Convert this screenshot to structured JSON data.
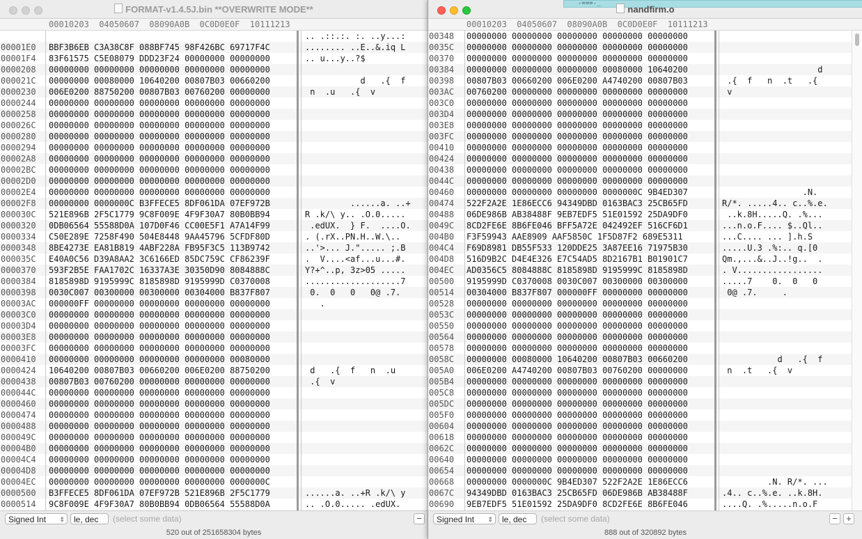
{
  "left": {
    "title": "FORMAT-v1.4.5J.bin **OVERWRITE MODE**",
    "col_headers": [
      "00010203",
      "04050607",
      "08090A0B",
      "0C0D0E0F",
      "10111213"
    ],
    "rows": [
      {
        "offset": "",
        "hex": "",
        "ascii": ".. .::.:. :. ..y...:"
      },
      {
        "offset": "00001E0",
        "hex": "BBF3B6EB C3A38C8F 088BF745 98F426BC 69717F4C",
        "ascii": "........ ..E..&.iq L"
      },
      {
        "offset": "00001F4",
        "hex": "83F61575 C5E08079 DDD23F24 00000000 00000000",
        "ascii": ".. u...y..?$"
      },
      {
        "offset": "0000208",
        "hex": "00000000 00000000 00000000 00000000 00000000",
        "ascii": ""
      },
      {
        "offset": "000021C",
        "hex": "00000000 00080000 10640200 00807B03 00660200",
        "ascii": "           d   .{  f"
      },
      {
        "offset": "0000230",
        "hex": "006E0200 88750200 00807B03 00760200 00000000",
        "ascii": " n  .u   .{  v"
      },
      {
        "offset": "0000244",
        "hex": "00000000 00000000 00000000 00000000 00000000",
        "ascii": ""
      },
      {
        "offset": "0000258",
        "hex": "00000000 00000000 00000000 00000000 00000000",
        "ascii": ""
      },
      {
        "offset": "000026C",
        "hex": "00000000 00000000 00000000 00000000 00000000",
        "ascii": ""
      },
      {
        "offset": "0000280",
        "hex": "00000000 00000000 00000000 00000000 00000000",
        "ascii": ""
      },
      {
        "offset": "0000294",
        "hex": "00000000 00000000 00000000 00000000 00000000",
        "ascii": ""
      },
      {
        "offset": "00002A8",
        "hex": "00000000 00000000 00000000 00000000 00000000",
        "ascii": ""
      },
      {
        "offset": "00002BC",
        "hex": "00000000 00000000 00000000 00000000 00000000",
        "ascii": ""
      },
      {
        "offset": "00002D0",
        "hex": "00000000 00000000 00000000 00000000 00000000",
        "ascii": ""
      },
      {
        "offset": "00002E4",
        "hex": "00000000 00000000 00000000 00000000 00000000",
        "ascii": ""
      },
      {
        "offset": "00002F8",
        "hex": "00000000 0000000C B3FFECE5 8DF061DA 07EF972B",
        "ascii": "         ......a. ..+"
      },
      {
        "offset": "000030C",
        "hex": "521E896B 2F5C1779 9C8F009E 4F9F30A7 80B0BB94",
        "ascii": "R .k/\\ y.. .O.0....."
      },
      {
        "offset": "0000320",
        "hex": "0DB06564 55588D0A 107D0F46 CC00E5F1 A7A14F99",
        "ascii": " .edUX.  } F.  ....O."
      },
      {
        "offset": "0000334",
        "hex": "C50E289E 7258F490 504E8448 9AA45796 5CFDF80D",
        "ascii": ". (.rX..PN.H..W.\\.."
      },
      {
        "offset": "0000348",
        "hex": "8BE4273E EA81B819 4ABF228A FB95F3C5 113B9742",
        "ascii": "..'>... J.\"..... ;.B"
      },
      {
        "offset": "000035C",
        "hex": "E40A0C56 D39A8AA2 3C6166ED 85DC759C CF86239F",
        "ascii": ".  V....<af...u...#."
      },
      {
        "offset": "0000370",
        "hex": "593F2B5E FAA1702C 16337A3E 30350D90 8084888C",
        "ascii": "Y?+^..p, 3z>05 ....."
      },
      {
        "offset": "0000384",
        "hex": "8185898D 9195999C 8185898D 9195999D C0370008",
        "ascii": "...................7"
      },
      {
        "offset": "0000398",
        "hex": "0030C007 00300000 00300000 00304000 B837F807",
        "ascii": " 0.  0   0   0@ .7."
      },
      {
        "offset": "00003AC",
        "hex": "000000FF 00000000 00000000 00000000 00000000",
        "ascii": "   ."
      },
      {
        "offset": "00003C0",
        "hex": "00000000 00000000 00000000 00000000 00000000",
        "ascii": ""
      },
      {
        "offset": "00003D4",
        "hex": "00000000 00000000 00000000 00000000 00000000",
        "ascii": ""
      },
      {
        "offset": "00003E8",
        "hex": "00000000 00000000 00000000 00000000 00000000",
        "ascii": ""
      },
      {
        "offset": "00003FC",
        "hex": "00000000 00000000 00000000 00000000 00000000",
        "ascii": ""
      },
      {
        "offset": "0000410",
        "hex": "00000000 00000000 00000000 00000000 00080000",
        "ascii": ""
      },
      {
        "offset": "0000424",
        "hex": "10640200 00807B03 00660200 006E0200 88750200",
        "ascii": " d   .{  f   n  .u"
      },
      {
        "offset": "0000438",
        "hex": "00807B03 00760200 00000000 00000000 00000000",
        "ascii": " .{  v"
      },
      {
        "offset": "000044C",
        "hex": "00000000 00000000 00000000 00000000 00000000",
        "ascii": ""
      },
      {
        "offset": "0000460",
        "hex": "00000000 00000000 00000000 00000000 00000000",
        "ascii": ""
      },
      {
        "offset": "0000474",
        "hex": "00000000 00000000 00000000 00000000 00000000",
        "ascii": ""
      },
      {
        "offset": "0000488",
        "hex": "00000000 00000000 00000000 00000000 00000000",
        "ascii": ""
      },
      {
        "offset": "000049C",
        "hex": "00000000 00000000 00000000 00000000 00000000",
        "ascii": ""
      },
      {
        "offset": "00004B0",
        "hex": "00000000 00000000 00000000 00000000 00000000",
        "ascii": ""
      },
      {
        "offset": "00004C4",
        "hex": "00000000 00000000 00000000 00000000 00000000",
        "ascii": ""
      },
      {
        "offset": "00004D8",
        "hex": "00000000 00000000 00000000 00000000 00000000",
        "ascii": ""
      },
      {
        "offset": "00004EC",
        "hex": "00000000 00000000 00000000 00000000 0000000C",
        "ascii": ""
      },
      {
        "offset": "0000500",
        "hex": "B3FFECE5 8DF061DA 07EF972B 521E896B 2F5C1779",
        "ascii": "......a. ..+R .k/\\ y"
      },
      {
        "offset": "0000514",
        "hex": "9C8F009E 4F9F30A7 80B0BB94 0DB06564 55588D0A",
        "ascii": ".. .O.0..... .edUX."
      },
      {
        "offset": "0000528",
        "hex": "107D0F46 CC00E5F1 A7A14F99 C50E289E 7258F490",
        "ascii": " } F.  ....O. . (.rX."
      }
    ],
    "status": {
      "type_select": "Signed Int",
      "endian_select": "le, dec",
      "hint": "(select some data)",
      "bytes": "520 out of 251658304 bytes"
    }
  },
  "right": {
    "title": "nandfirm.o",
    "teal_text": "-===-_",
    "col_headers": [
      "00010203",
      "04050607",
      "08090A0B",
      "0C0D0E0F",
      "10111213"
    ],
    "rows": [
      {
        "offset": "00348",
        "hex": "00000000 00000000 00000000 00000000 00000000",
        "ascii": ""
      },
      {
        "offset": "0035C",
        "hex": "00000000 00000000 00000000 00000000 00000000",
        "ascii": ""
      },
      {
        "offset": "00370",
        "hex": "00000000 00000000 00000000 00000000 00000000",
        "ascii": ""
      },
      {
        "offset": "00384",
        "hex": "00000000 00000000 00000000 00080000 10640200",
        "ascii": "                   d"
      },
      {
        "offset": "00398",
        "hex": "00807B03 00660200 006E0200 A4740200 00807B03",
        "ascii": " .{  f   n  .t   .{"
      },
      {
        "offset": "003AC",
        "hex": "00760200 00000000 00000000 00000000 00000000",
        "ascii": " v"
      },
      {
        "offset": "003C0",
        "hex": "00000000 00000000 00000000 00000000 00000000",
        "ascii": ""
      },
      {
        "offset": "003D4",
        "hex": "00000000 00000000 00000000 00000000 00000000",
        "ascii": ""
      },
      {
        "offset": "003E8",
        "hex": "00000000 00000000 00000000 00000000 00000000",
        "ascii": ""
      },
      {
        "offset": "003FC",
        "hex": "00000000 00000000 00000000 00000000 00000000",
        "ascii": ""
      },
      {
        "offset": "00410",
        "hex": "00000000 00000000 00000000 00000000 00000000",
        "ascii": ""
      },
      {
        "offset": "00424",
        "hex": "00000000 00000000 00000000 00000000 00000000",
        "ascii": ""
      },
      {
        "offset": "00438",
        "hex": "00000000 00000000 00000000 00000000 00000000",
        "ascii": ""
      },
      {
        "offset": "0044C",
        "hex": "00000000 00000000 00000000 00000000 00000000",
        "ascii": ""
      },
      {
        "offset": "00460",
        "hex": "00000000 00000000 00000000 0000000C 9B4ED307",
        "ascii": "                .N."
      },
      {
        "offset": "00474",
        "hex": "522F2A2E 1E86ECC6 94349DBD 0163BAC3 25CB65FD",
        "ascii": "R/*. .....4.. c..%.e."
      },
      {
        "offset": "00488",
        "hex": "06DE986B AB38488F 9EB7EDF5 51E01592 25DA9DF0",
        "ascii": " ..k.8H.....Q. .%..."
      },
      {
        "offset": "0049C",
        "hex": "8CD2FE6E 8B6FE046 BFF5A72E 042492EF 516CF6D1",
        "ascii": "...n.o.F.... $..Ql.."
      },
      {
        "offset": "004B0",
        "hex": "F3F59943 AAE8909 AAF5850C 1F5D87F2 689E5311",
        "ascii": "...C.... ... ].h.S"
      },
      {
        "offset": "004C4",
        "hex": "F69D8981 DB55F533 120DDE25 3A87EE16 71975B30",
        "ascii": ".....U.3 .%:.. q.[0"
      },
      {
        "offset": "004D8",
        "hex": "516D9B2C D4E4E326 E7C54AD5 8D2167B1 B01901C7",
        "ascii": "Qm.,...&..J..!g..  ."
      },
      {
        "offset": "004EC",
        "hex": "AD0356C5 8084888C 8185898D 9195999C 8185898D",
        "ascii": ". V................."
      },
      {
        "offset": "00500",
        "hex": "9195999D C0370008 0030C007 00300000 00300000",
        "ascii": ".....7    0.  0   0"
      },
      {
        "offset": "00514",
        "hex": "00304000 B837F807 000000FF 00000000 00000000",
        "ascii": " 0@ .7.     ."
      },
      {
        "offset": "00528",
        "hex": "00000000 00000000 00000000 00000000 00000000",
        "ascii": ""
      },
      {
        "offset": "0053C",
        "hex": "00000000 00000000 00000000 00000000 00000000",
        "ascii": ""
      },
      {
        "offset": "00550",
        "hex": "00000000 00000000 00000000 00000000 00000000",
        "ascii": ""
      },
      {
        "offset": "00564",
        "hex": "00000000 00000000 00000000 00000000 00000000",
        "ascii": ""
      },
      {
        "offset": "00578",
        "hex": "00000000 00000000 00000000 00000000 00000000",
        "ascii": ""
      },
      {
        "offset": "0058C",
        "hex": "00000000 00080000 10640200 00807B03 00660200",
        "ascii": "           d   .{  f"
      },
      {
        "offset": "005A0",
        "hex": "006E0200 A4740200 00807B03 00760200 00000000",
        "ascii": " n  .t   .{  v"
      },
      {
        "offset": "005B4",
        "hex": "00000000 00000000 00000000 00000000 00000000",
        "ascii": ""
      },
      {
        "offset": "005C8",
        "hex": "00000000 00000000 00000000 00000000 00000000",
        "ascii": ""
      },
      {
        "offset": "005DC",
        "hex": "00000000 00000000 00000000 00000000 00000000",
        "ascii": ""
      },
      {
        "offset": "005F0",
        "hex": "00000000 00000000 00000000 00000000 00000000",
        "ascii": ""
      },
      {
        "offset": "00604",
        "hex": "00000000 00000000 00000000 00000000 00000000",
        "ascii": ""
      },
      {
        "offset": "00618",
        "hex": "00000000 00000000 00000000 00000000 00000000",
        "ascii": ""
      },
      {
        "offset": "0062C",
        "hex": "00000000 00000000 00000000 00000000 00000000",
        "ascii": ""
      },
      {
        "offset": "00640",
        "hex": "00000000 00000000 00000000 00000000 00000000",
        "ascii": ""
      },
      {
        "offset": "00654",
        "hex": "00000000 00000000 00000000 00000000 00000000",
        "ascii": ""
      },
      {
        "offset": "00668",
        "hex": "00000000 0000000C 9B4ED307 522F2A2E 1E86ECC6",
        "ascii": "         .N. R/*. ..."
      },
      {
        "offset": "0067C",
        "hex": "94349DBD 0163BAC3 25CB65FD 06DE986B AB38488F",
        "ascii": ".4.. c..%.e. ..k.8H."
      },
      {
        "offset": "00690",
        "hex": "9EB7EDF5 51E01592 25DA9DF0 8CD2FE6E 8B6FE046",
        "ascii": "....Q. .%.....n.o.F"
      }
    ],
    "status": {
      "type_select": "Signed Int",
      "endian_select": "le, dec",
      "hint": "(select some data)",
      "bytes": "888 out of 320892 bytes"
    }
  }
}
